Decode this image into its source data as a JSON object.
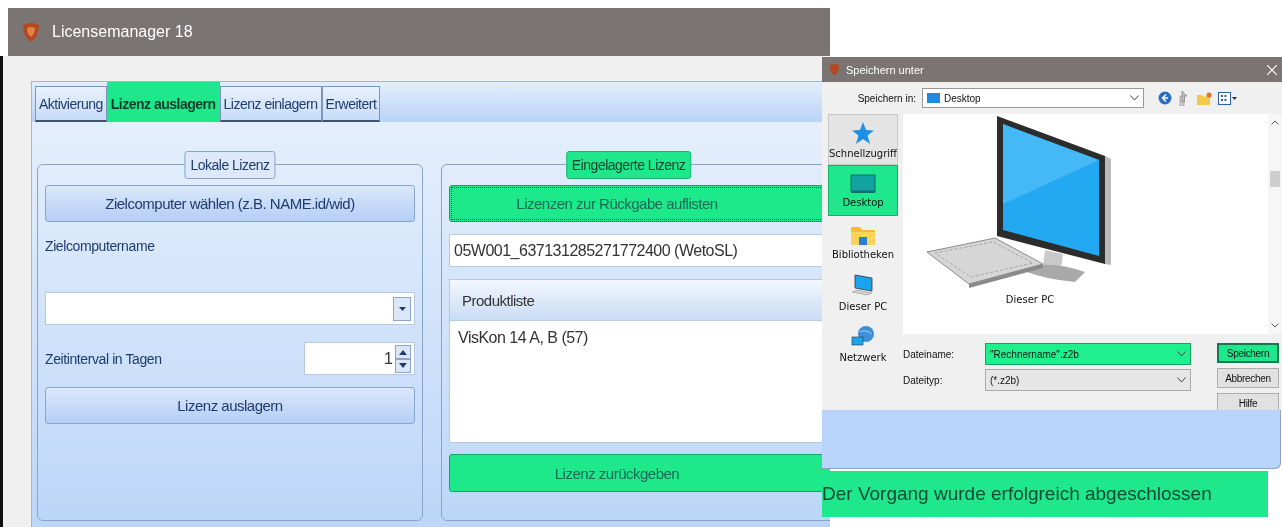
{
  "main_window": {
    "title": "Licensemanager 18"
  },
  "tabs": [
    {
      "label": "Aktivierung",
      "selected": false
    },
    {
      "label": "Lizenz auslagern",
      "selected": true
    },
    {
      "label": "Lizenz einlagern",
      "selected": false
    },
    {
      "label": "Erweitert",
      "selected": false
    }
  ],
  "local_license": {
    "legend": "Lokale Lizenz",
    "highlighted": false,
    "select_button": {
      "label": "Zielcomputer wählen (z.B. NAME.id/wid)",
      "highlighted": false
    },
    "computer_name_label": "Zielcomputername",
    "interval_label": "Zeitinterval in Tagen",
    "interval_value": "1",
    "export_button": {
      "label": "Lizenz auslagern",
      "highlighted": false
    }
  },
  "stored_license": {
    "legend": "Eingelagerte Lizenz",
    "highlighted": true,
    "list_button": {
      "label": "Lizenzen zur Rückgabe auflisten",
      "highlighted": true
    },
    "license_select": "05W001_637131285271772400 (WetoSL)",
    "product_list": {
      "header": "Produktliste",
      "items": [
        "VisKon 14 A, B (57)"
      ]
    },
    "return_button": {
      "label": "Lizenz zurückgeben",
      "highlighted": true
    }
  },
  "save_dialog": {
    "title": "Speichern unter",
    "location_label": "Speichern in:",
    "location": "Desktop",
    "places": [
      {
        "label": "Schnellzugriff",
        "kind": "star",
        "selected": false
      },
      {
        "label": "Desktop",
        "kind": "desktop",
        "selected": true
      },
      {
        "label": "Bibliotheken",
        "kind": "library",
        "selected": false
      },
      {
        "label": "Dieser PC",
        "kind": "pc",
        "selected": false
      },
      {
        "label": "Netzwerk",
        "kind": "network",
        "selected": false
      }
    ],
    "files": [
      {
        "label": "Dieser PC"
      }
    ],
    "filename_label": "Dateiname:",
    "filename": "\"Rechnername\".z2b",
    "filetype_label": "Dateityp:",
    "filetype": "(*.z2b)",
    "buttons": [
      {
        "label": "Speichern",
        "highlighted": true
      },
      {
        "label": "Abbrechen",
        "highlighted": false
      },
      {
        "label": "Hilfe",
        "highlighted": false
      }
    ]
  },
  "status": "Der Vorgang wurde erfolgreich abgeschlossen"
}
